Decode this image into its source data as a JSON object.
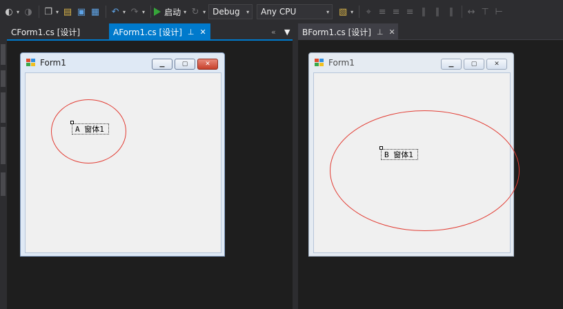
{
  "toolbar": {
    "run_label": "启动",
    "config": "Debug",
    "platform": "Any CPU"
  },
  "tabs_left": [
    {
      "label": "CForm1.cs [设计]",
      "active": false
    },
    {
      "label": "AForm1.cs [设计]",
      "active": true
    }
  ],
  "tabs_right": [
    {
      "label": "BForm1.cs [设计]",
      "active": false
    }
  ],
  "form_a": {
    "title": "Form1",
    "label_text": "A 窗体1"
  },
  "form_b": {
    "title": "Form1",
    "label_text": "B 窗体1"
  },
  "colors": {
    "accent": "#007acc",
    "ellipse": "#e23c33",
    "run": "#36a53a"
  },
  "icons": {
    "toolbar": [
      "back-icon",
      "forward-icon",
      "new-project-icon",
      "open-icon",
      "save-icon",
      "save-all-icon",
      "undo-icon",
      "redo-icon",
      "start-icon",
      "attach-icon",
      "find-icon",
      "align-icon"
    ]
  }
}
